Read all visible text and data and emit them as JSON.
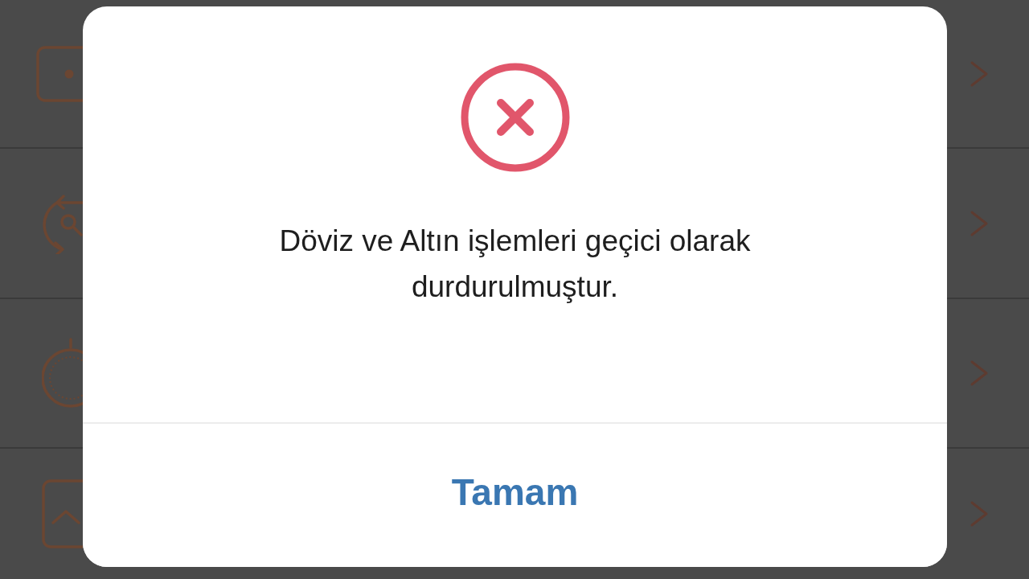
{
  "dialog": {
    "message": "Döviz ve Altın işlemleri geçici olarak durdurulmuştur.",
    "buttons": [
      "Tamam"
    ]
  }
}
